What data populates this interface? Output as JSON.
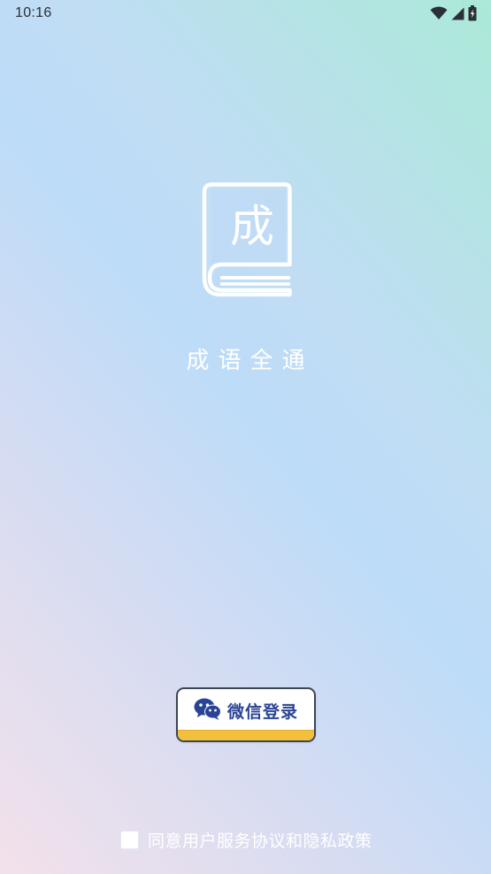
{
  "status_bar": {
    "time": "10:16",
    "icons": [
      "wifi-icon",
      "cell-signal-icon",
      "battery-charging-icon"
    ]
  },
  "logo": {
    "glyph": "成",
    "icon": "idiom-book-icon"
  },
  "app_name": "成语全通",
  "login": {
    "wechat_label": "微信登录",
    "icon": "wechat-icon"
  },
  "agreement": {
    "text": "同意用户服务协议和隐私政策",
    "checked": false
  },
  "colors": {
    "button_text": "#2a4495",
    "button_base": "#f2c03c",
    "button_border": "#3c4555"
  }
}
